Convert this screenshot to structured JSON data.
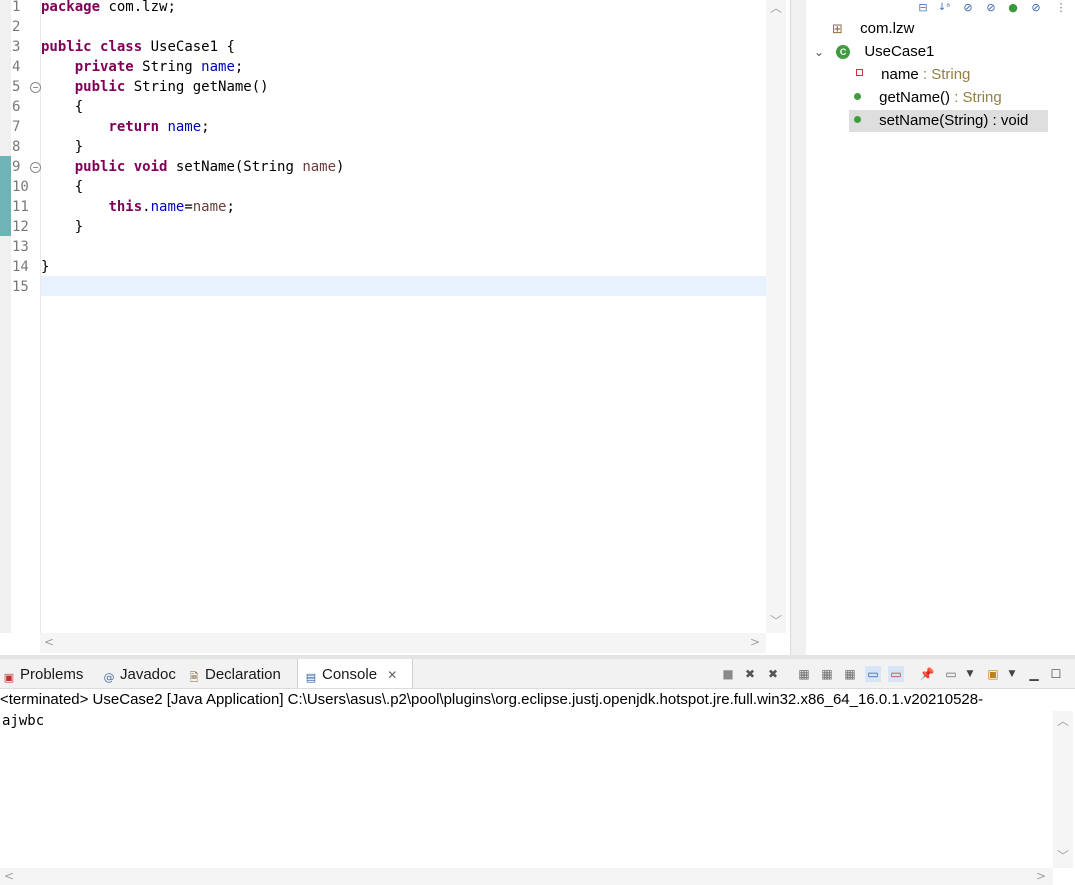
{
  "editor": {
    "lines": [
      {
        "n": "1",
        "parts": [
          {
            "t": "package",
            "c": "kw"
          },
          {
            "t": " com.lzw;",
            "c": ""
          }
        ]
      },
      {
        "n": "2",
        "parts": []
      },
      {
        "n": "3",
        "parts": [
          {
            "t": "public",
            "c": "kw"
          },
          {
            "t": " ",
            "c": ""
          },
          {
            "t": "class",
            "c": "kw"
          },
          {
            "t": " UseCase1 {",
            "c": ""
          }
        ]
      },
      {
        "n": "4",
        "parts": [
          {
            "t": "    ",
            "c": ""
          },
          {
            "t": "private",
            "c": "kw"
          },
          {
            "t": " String ",
            "c": ""
          },
          {
            "t": "name",
            "c": "fld"
          },
          {
            "t": ";",
            "c": ""
          }
        ]
      },
      {
        "n": "5",
        "fold": true,
        "parts": [
          {
            "t": "    ",
            "c": ""
          },
          {
            "t": "public",
            "c": "kw"
          },
          {
            "t": " String getName()",
            "c": ""
          }
        ]
      },
      {
        "n": "6",
        "parts": [
          {
            "t": "    {",
            "c": ""
          }
        ]
      },
      {
        "n": "7",
        "parts": [
          {
            "t": "        ",
            "c": ""
          },
          {
            "t": "return",
            "c": "kw"
          },
          {
            "t": " ",
            "c": ""
          },
          {
            "t": "name",
            "c": "fld"
          },
          {
            "t": ";",
            "c": ""
          }
        ]
      },
      {
        "n": "8",
        "parts": [
          {
            "t": "    }",
            "c": ""
          }
        ]
      },
      {
        "n": "9",
        "fold": true,
        "parts": [
          {
            "t": "    ",
            "c": ""
          },
          {
            "t": "public",
            "c": "kw"
          },
          {
            "t": " ",
            "c": ""
          },
          {
            "t": "void",
            "c": "kw"
          },
          {
            "t": " setName(String ",
            "c": ""
          },
          {
            "t": "name",
            "c": "par"
          },
          {
            "t": ")",
            "c": ""
          }
        ]
      },
      {
        "n": "10",
        "parts": [
          {
            "t": "    {",
            "c": ""
          }
        ]
      },
      {
        "n": "11",
        "parts": [
          {
            "t": "        ",
            "c": ""
          },
          {
            "t": "this",
            "c": "kw"
          },
          {
            "t": ".",
            "c": ""
          },
          {
            "t": "name",
            "c": "fld"
          },
          {
            "t": "=",
            "c": ""
          },
          {
            "t": "name",
            "c": "par"
          },
          {
            "t": ";",
            "c": ""
          }
        ]
      },
      {
        "n": "12",
        "parts": [
          {
            "t": "    }",
            "c": ""
          }
        ]
      },
      {
        "n": "13",
        "parts": []
      },
      {
        "n": "14",
        "parts": [
          {
            "t": "}",
            "c": ""
          }
        ]
      },
      {
        "n": "15",
        "parts": []
      }
    ]
  },
  "outline": {
    "package": "com.lzw",
    "class": "UseCase1",
    "field_name": "name",
    "field_type": " : String",
    "method1_name": "getName()",
    "method1_type": " : String",
    "method2_name": "setName(String) : void"
  },
  "panel": {
    "tabs": {
      "problems": "Problems",
      "javadoc": "Javadoc",
      "declaration": "Declaration",
      "console": "Console"
    },
    "console_header": "<terminated> UseCase2 [Java Application] C:\\Users\\asus\\.p2\\pool\\plugins\\org.eclipse.justj.openjdk.hotspot.jre.full.win32.x86_64_16.0.1.v20210528-",
    "console_output": "ajwbc"
  },
  "colors": {
    "keyword": "#7f0055",
    "field": "#0000c0",
    "parameter": "#6a3e3e",
    "outline_type": "#957d47",
    "current_line": "#e8f2fe",
    "change_bar": "#6fb4b4"
  }
}
